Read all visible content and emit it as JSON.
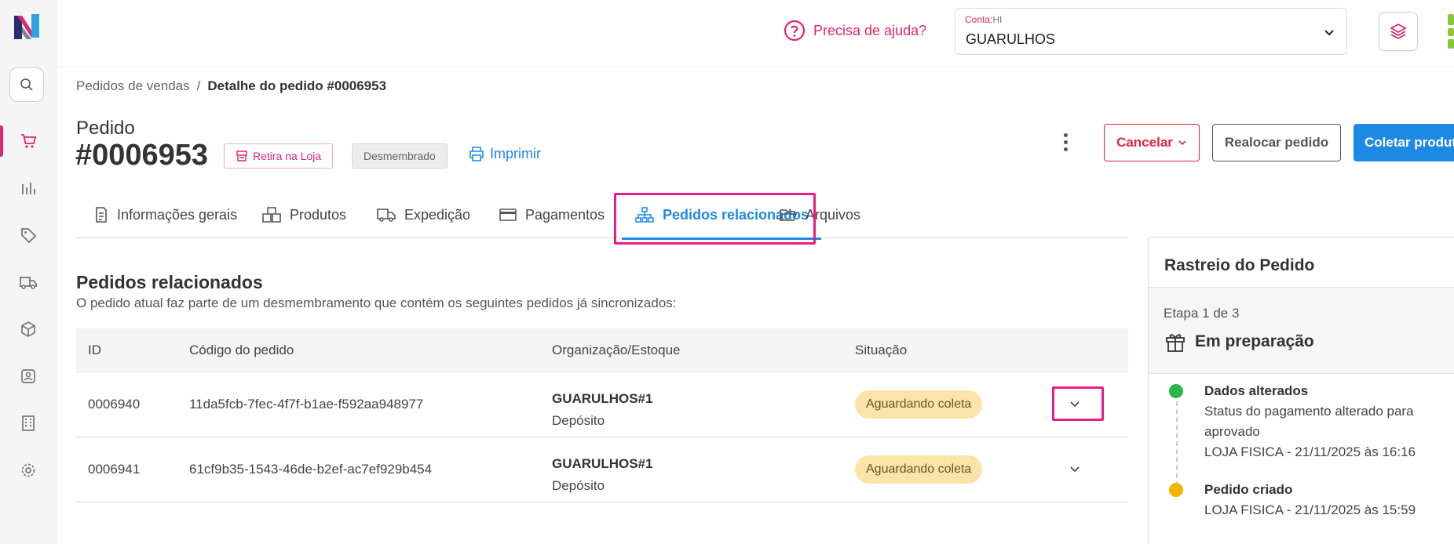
{
  "topbar": {
    "help_label": "Precisa de ajuda?",
    "account_label": "Conta:",
    "account_code": "HI",
    "account_value": "GUARULHOS"
  },
  "breadcrumb": {
    "parent": "Pedidos de vendas",
    "separator": "/",
    "current": "Detalhe do pedido #0006953"
  },
  "order": {
    "label": "Pedido",
    "number": "#0006953",
    "pickup_badge": "Retira na Loja",
    "split_badge": "Desmembrado",
    "print_label": "Imprimir"
  },
  "actions": {
    "cancel": "Cancelar",
    "reallocate": "Realocar pedido",
    "collect": "Coletar produtos"
  },
  "tabs": [
    {
      "label": "Informações gerais",
      "icon": "document-icon"
    },
    {
      "label": "Produtos",
      "icon": "boxes-icon"
    },
    {
      "label": "Expedição",
      "icon": "truck-icon"
    },
    {
      "label": "Pagamentos",
      "icon": "card-icon"
    },
    {
      "label": "Pedidos relacionados",
      "icon": "hierarchy-icon",
      "active": true
    },
    {
      "label": "Arquivos",
      "icon": "folder-icon"
    }
  ],
  "related": {
    "title": "Pedidos relacionados",
    "description": "O pedido atual faz parte de um desmembramento que contém os seguintes pedidos já sincronizados:",
    "columns": [
      "ID",
      "Código do pedido",
      "Organização/Estoque",
      "Situação"
    ],
    "rows": [
      {
        "id": "0006940",
        "code": "11da5fcb-7fec-4f7f-b1ae-f592aa948977",
        "org": "GUARULHOS#1",
        "stock": "Depósito",
        "status": "Aguardando coleta"
      },
      {
        "id": "0006941",
        "code": "61cf9b35-1543-46de-b2ef-ac7ef929b454",
        "org": "GUARULHOS#1",
        "stock": "Depósito",
        "status": "Aguardando coleta"
      }
    ]
  },
  "tracking": {
    "title": "Rastreio do Pedido",
    "step": "Etapa 1 de 3",
    "stage": "Em preparação",
    "events": [
      {
        "title": "Dados alterados",
        "line1": "Status do pagamento alterado para",
        "line2": "aprovado",
        "line3": "LOJA FISICA - 21/11/2025 às 16:16",
        "color": "#2bb84a"
      },
      {
        "title": "Pedido criado",
        "line1": "LOJA FISICA - 21/11/2025 às 15:59",
        "color": "#f5b400"
      }
    ]
  },
  "colors": {
    "accent": "#e0266f",
    "primary": "#1e88e5",
    "highlight": "#ec1b8c",
    "status_bg": "#fce4a8"
  }
}
